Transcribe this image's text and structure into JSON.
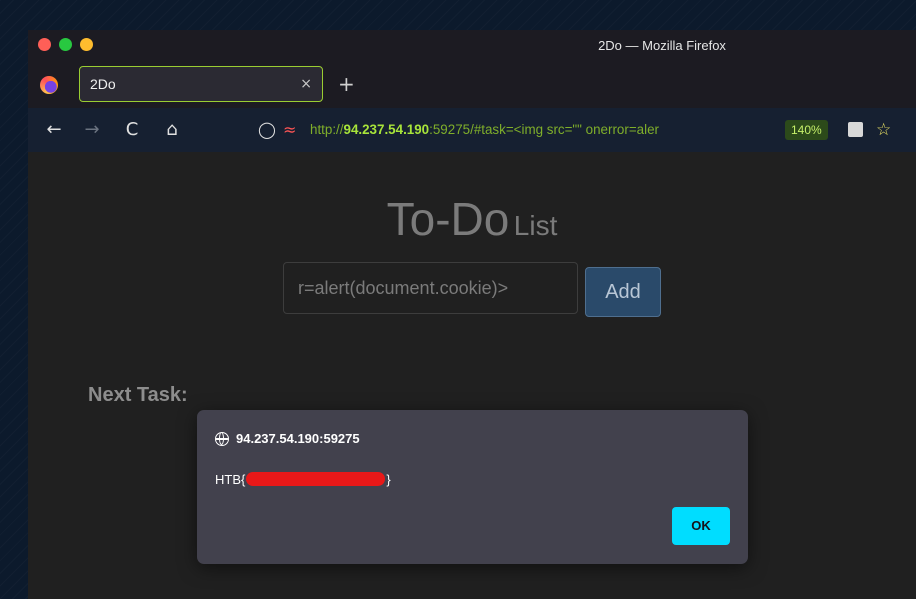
{
  "window": {
    "title": "2Do — Mozilla Firefox"
  },
  "tab": {
    "title": "2Do",
    "close_glyph": "×",
    "new_tab_glyph": "+"
  },
  "nav": {
    "back_glyph": "←",
    "forward_glyph": "→",
    "reload_glyph": "C",
    "home_glyph": "⌂",
    "url_prefix": "http://",
    "url_host": "94.237.54.190",
    "url_rest": ":59275/#task=<img src=\"\" onerror=aler",
    "zoom": "140%"
  },
  "page": {
    "heading_big": "To-Do",
    "heading_small": "List",
    "input_value": "r=alert(document.cookie)>",
    "add_label": "Add",
    "next_task_label": "Next Task:"
  },
  "dialog": {
    "origin": "94.237.54.190:59275",
    "message_prefix": "HTB{",
    "message_suffix": "}",
    "ok_label": "OK"
  },
  "colors": {
    "accent_cyan": "#00ddff",
    "redaction": "#e81818",
    "url_green": "#7fae2a",
    "tab_border": "#9acd32"
  }
}
